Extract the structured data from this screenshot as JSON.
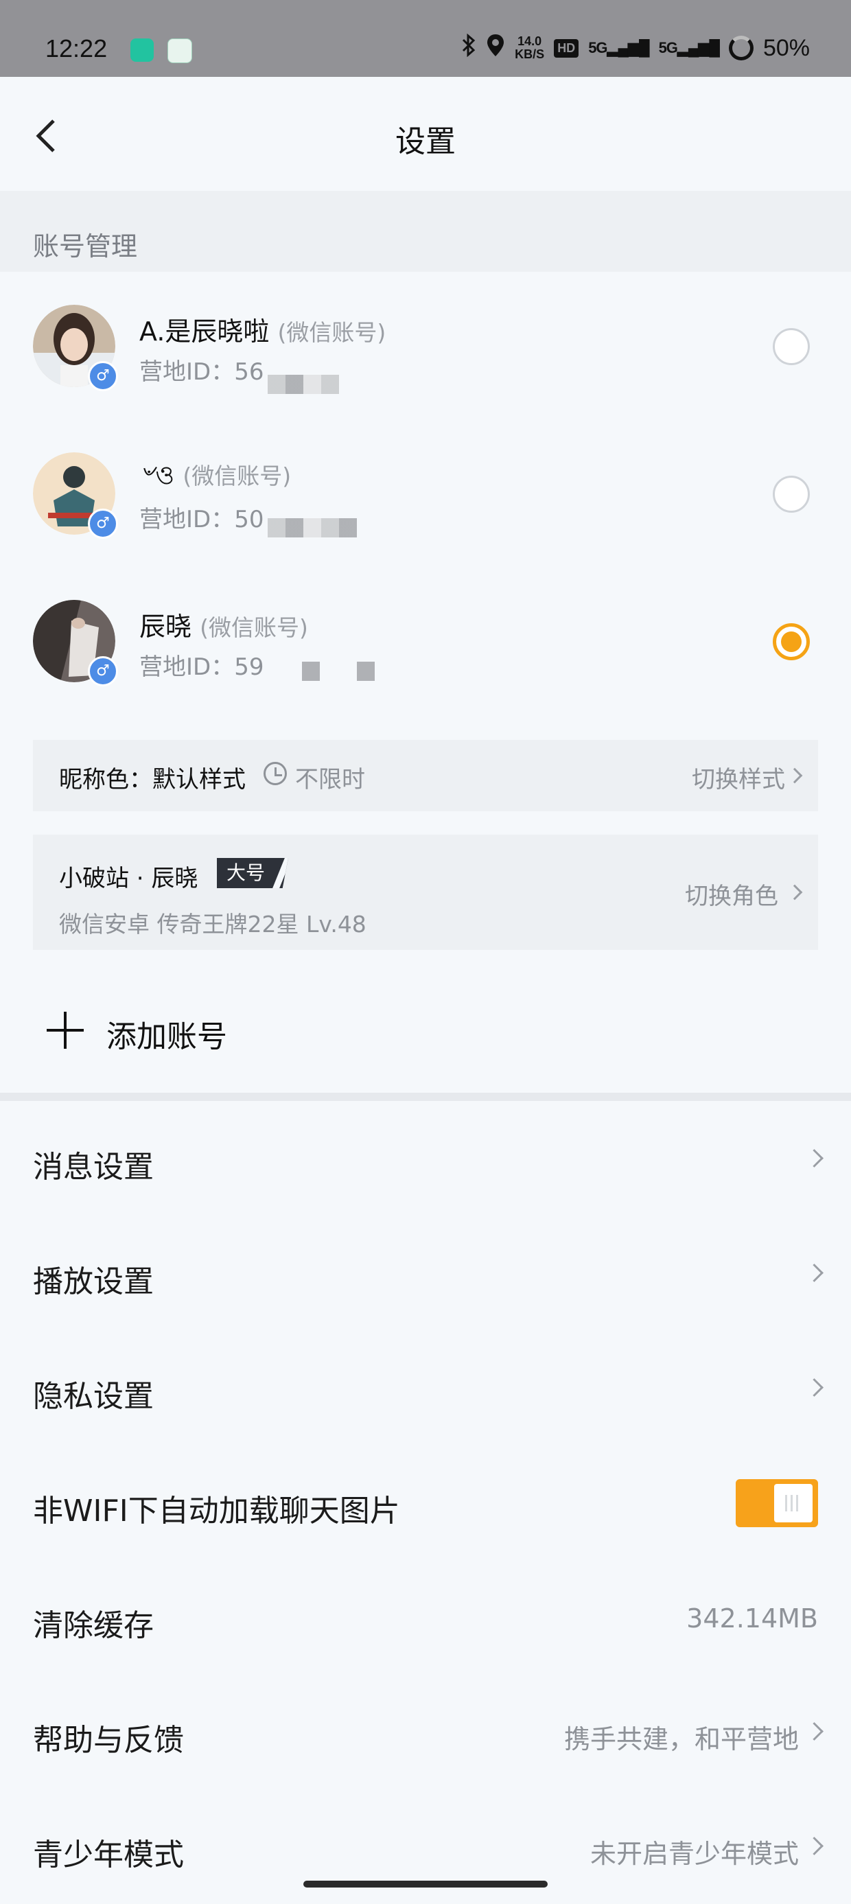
{
  "status_bar": {
    "time": "12:22",
    "net_speed_value": "14.0",
    "net_speed_unit": "KB/S",
    "hd": "HD",
    "signal1": "5G",
    "signal2": "5G",
    "battery": "50%"
  },
  "header": {
    "title": "设置"
  },
  "accounts_section": {
    "title": "账号管理"
  },
  "accounts": [
    {
      "name": "A.是辰晓啦",
      "tag": "(微信账号)",
      "id_label": "营地ID：",
      "id_visible": "56",
      "gender": "♂",
      "selected": false
    },
    {
      "name": "৺ও",
      "tag": "(微信账号)",
      "id_label": "营地ID：",
      "id_visible": "50",
      "gender": "♂",
      "selected": false
    },
    {
      "name": "辰晓",
      "tag": "(微信账号)",
      "id_label": "营地ID：",
      "id_visible": "59",
      "gender": "♂",
      "selected": true
    }
  ],
  "nickname_color": {
    "label": "昵称色：默认样式",
    "duration": "不限时",
    "action": "切换样式"
  },
  "role": {
    "name": "小破站 · 辰晓",
    "badge": "大号",
    "info": "微信安卓  传奇王牌22星  Lv.48",
    "action": "切换角色"
  },
  "add_account": {
    "label": "添加账号"
  },
  "settings": [
    {
      "label": "消息设置",
      "value": ""
    },
    {
      "label": "播放设置",
      "value": ""
    },
    {
      "label": "隐私设置",
      "value": ""
    },
    {
      "label": "非WIFI下自动加载聊天图片",
      "toggle_on": true
    },
    {
      "label": "清除缓存",
      "value": "342.14MB"
    },
    {
      "label": "帮助与反馈",
      "value": "携手共建，和平营地"
    },
    {
      "label": "青少年模式",
      "value": "未开启青少年模式"
    }
  ],
  "colors": {
    "accent": "#f5a315",
    "gender_badge": "#4d8ce6"
  }
}
